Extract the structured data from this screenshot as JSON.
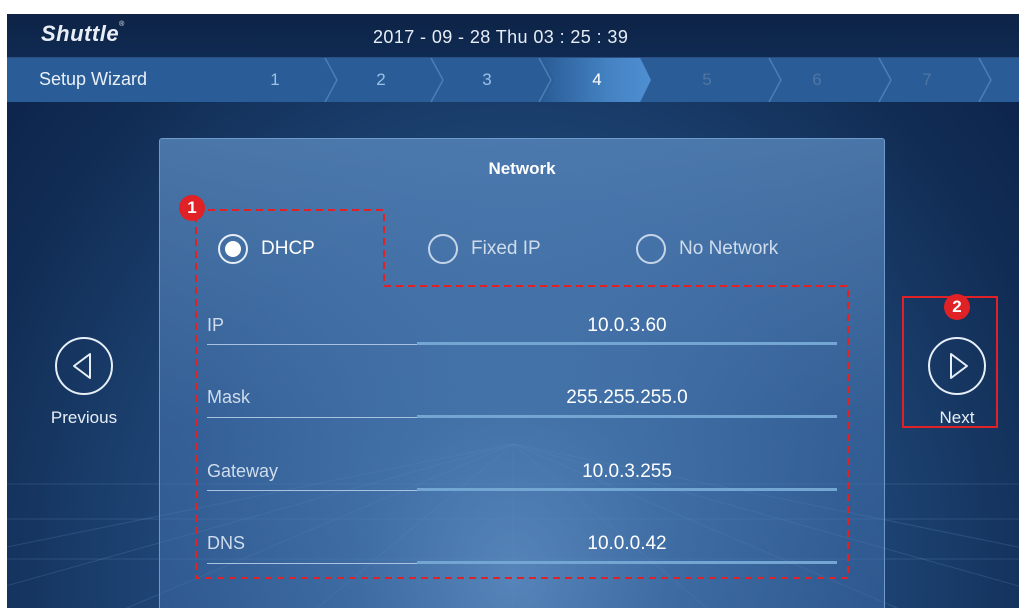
{
  "header": {
    "brand": "Shuttle",
    "brand_mark": "®",
    "datetime": "2017 - 09 - 28  Thu  03 : 25 : 39"
  },
  "wizard": {
    "title": "Setup Wizard",
    "steps": [
      "1",
      "2",
      "3",
      "4",
      "5",
      "6",
      "7"
    ],
    "current_step": 4
  },
  "panel": {
    "title": "Network",
    "mode_options": [
      {
        "label": "DHCP",
        "selected": true
      },
      {
        "label": "Fixed IP",
        "selected": false
      },
      {
        "label": "No Network",
        "selected": false
      }
    ],
    "fields": [
      {
        "label": "IP",
        "value": "10.0.3.60"
      },
      {
        "label": "Mask",
        "value": "255.255.255.0"
      },
      {
        "label": "Gateway",
        "value": "10.0.3.255"
      },
      {
        "label": "DNS",
        "value": "10.0.0.42"
      }
    ]
  },
  "navigation": {
    "previous_label": "Previous",
    "next_label": "Next",
    "previous_icon": "chevron-left-circle-icon",
    "next_icon": "chevron-right-circle-icon"
  },
  "annotations": {
    "badge_1": "1",
    "badge_2": "2",
    "color": "#e02125"
  },
  "colors": {
    "background": "#1f4677",
    "wizard_bar": "#2a5d97",
    "panel": "#5c8cc2",
    "annotation": "#e02125"
  }
}
